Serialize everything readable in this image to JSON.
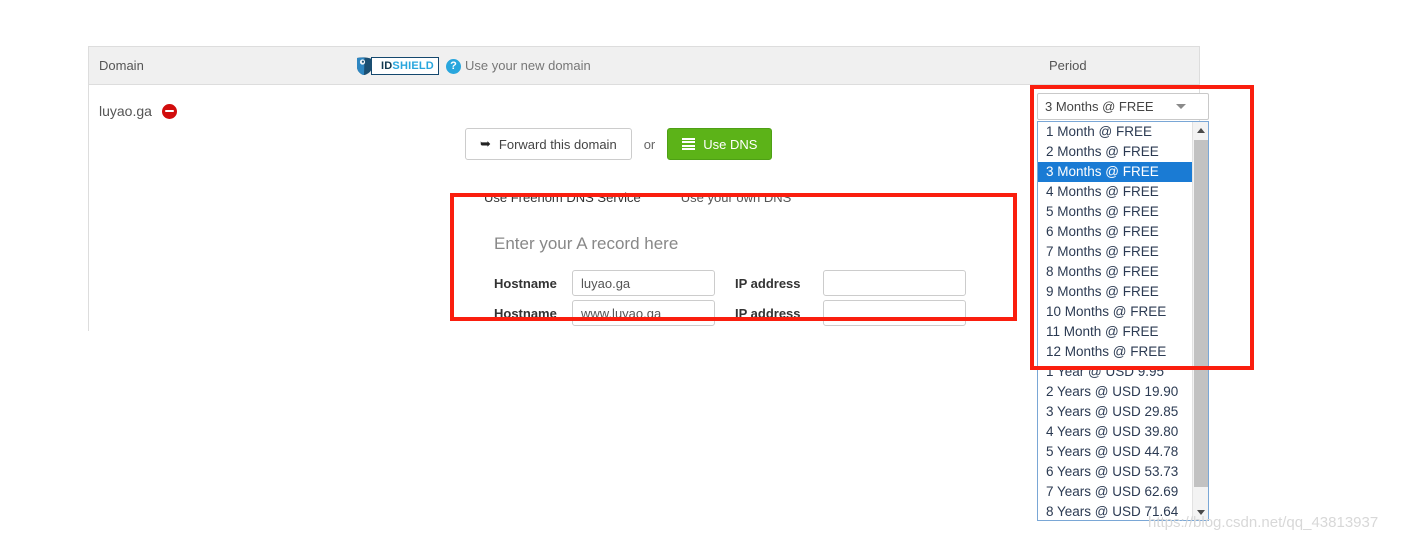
{
  "panel": {
    "header": {
      "domain_label": "Domain",
      "use_new_domain_label": "Use your new domain",
      "period_label": "Period",
      "idshield": {
        "icon": "shield-icon",
        "text_id": "ID",
        "text_shield": "SHIELD",
        "help_icon": "?"
      }
    },
    "row": {
      "domain_name": "luyao.ga",
      "delete_icon": "no-entry-icon"
    }
  },
  "actions": {
    "forward_icon": "forward-arrow-icon",
    "forward_label": "Forward this domain",
    "or_label": "or",
    "dns_icon": "list-lines-icon",
    "dns_label": "Use DNS"
  },
  "tabs": [
    {
      "label": "Use Freenom DNS Service",
      "active": true
    },
    {
      "label": "Use your own DNS",
      "active": false
    }
  ],
  "a_record": {
    "title": "Enter your A record here",
    "rows": [
      {
        "hostname_label": "Hostname",
        "hostname_value": "luyao.ga",
        "ip_label": "IP address",
        "ip_value": ""
      },
      {
        "hostname_label": "Hostname",
        "hostname_value": "www.luyao.ga",
        "ip_label": "IP address",
        "ip_value": ""
      }
    ]
  },
  "period": {
    "selected": "3 Months @ FREE",
    "caret_icon": "chevron-down-icon",
    "options": [
      "1 Month @ FREE",
      "2 Months @ FREE",
      "3 Months @ FREE",
      "4 Months @ FREE",
      "5 Months @ FREE",
      "6 Months @ FREE",
      "7 Months @ FREE",
      "8 Months @ FREE",
      "9 Months @ FREE",
      "10 Months @ FREE",
      "11 Month @ FREE",
      "12 Months @ FREE",
      "1 Year @ USD 9.95",
      "2 Years @ USD 19.90",
      "3 Years @ USD 29.85",
      "4 Years @ USD 39.80",
      "5 Years @ USD 44.78",
      "6 Years @ USD 53.73",
      "7 Years @ USD 62.69",
      "8 Years @ USD 71.64"
    ],
    "selected_index": 2,
    "scroll_up_icon": "scroll-up-arrow-icon",
    "scroll_down_icon": "scroll-down-arrow-icon"
  },
  "annotations": {
    "highlight_color": "#fa1e0e",
    "boxes": [
      "a-record-form",
      "period-dropdown"
    ]
  },
  "watermark": "https://blog.csdn.net/qq_43813937"
}
